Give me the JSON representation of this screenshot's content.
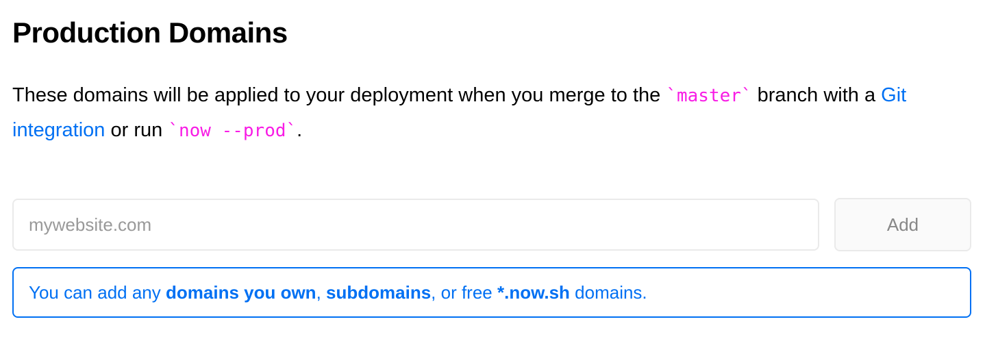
{
  "header": {
    "title": "Production Domains"
  },
  "description": {
    "before_branch": "These domains will be applied to your deployment when you merge to the ",
    "branch_code": "`master`",
    "after_branch": " branch with a ",
    "git_link": "Git integration",
    "before_command": " or run ",
    "command_code": "`now --prod`",
    "end": "."
  },
  "domain_form": {
    "input_placeholder": "mywebsite.com",
    "input_value": "",
    "add_label": "Add"
  },
  "note": {
    "prefix": "You can add any ",
    "domains_owned": "domains you own",
    "sep1": ", ",
    "subdomains": "subdomains",
    "middle": ", or free ",
    "now_sh": "*.now.sh",
    "suffix": " domains."
  },
  "colors": {
    "link_blue": "#0070f3",
    "code_pink": "#f81ce5",
    "border_gray": "#eaeaea"
  }
}
